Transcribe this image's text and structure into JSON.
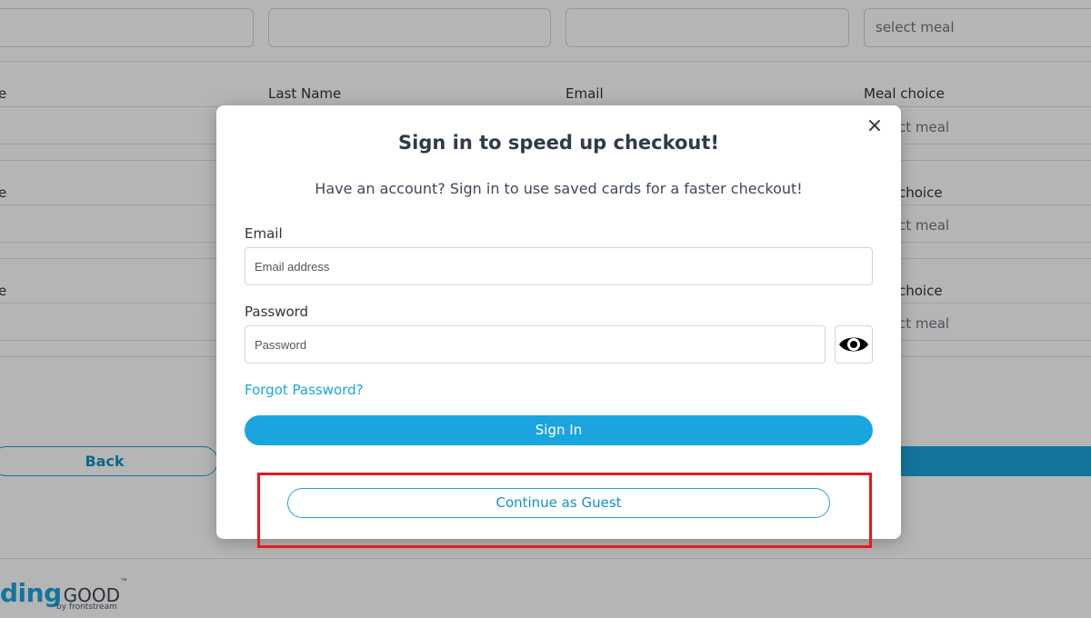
{
  "background": {
    "top_fields": [
      "",
      "",
      "",
      "select meal"
    ],
    "header_labels": {
      "name_fragment": "e",
      "last_name": "Last Name",
      "email": "Email",
      "meal_choice": "Meal choice"
    },
    "row_fragments": [
      "e",
      "e"
    ],
    "meal_fragment": "ct meal",
    "choice_fragment": "choice",
    "back_label": "Back",
    "brand": {
      "main": "ding",
      "good": "GOOD",
      "tm": "™",
      "sub": "by frontstream"
    }
  },
  "modal": {
    "title": "Sign in to speed up checkout!",
    "subtitle": "Have an account? Sign in to use saved cards for a faster checkout!",
    "close_symbol": "×",
    "email_label": "Email",
    "email_placeholder": "Email address",
    "email_value": "",
    "password_label": "Password",
    "password_placeholder": "Password",
    "password_value": "",
    "forgot_label": "Forgot Password?",
    "signin_label": "Sign In",
    "guest_label": "Continue as Guest",
    "eye_icon": "eye-icon"
  },
  "colors": {
    "accent": "#1ba5de",
    "highlight": "#e3191c",
    "overlay": "rgba(0,0,0,0.29)"
  }
}
